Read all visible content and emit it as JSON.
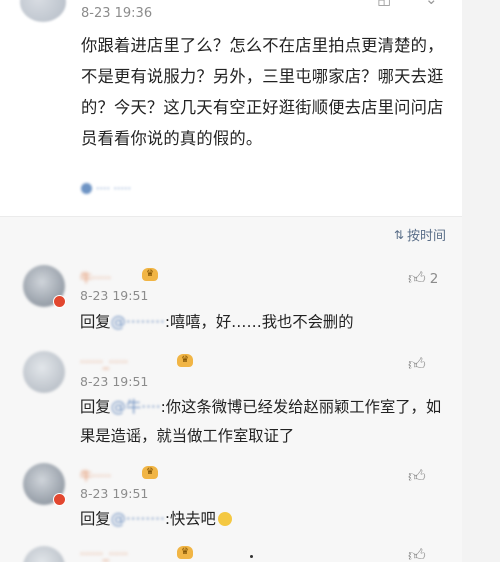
{
  "post": {
    "time": "8-23 19:36",
    "text": "你跟着进店里了么？怎么不在店里拍点更清楚的，不是更有说服力？另外，三里屯哪家店？哪天去逛的？今天？这几天有空正好逛街顺便去店里问问店员看看你说的真的假的。",
    "location_tag": "···· ·····",
    "actions": [
      "forward-icon",
      "more-icon"
    ]
  },
  "sort": {
    "label": "按时间",
    "icon": "sort-icon"
  },
  "comments": [
    {
      "name": "牛·····",
      "vip": "♛",
      "time": "8-23 19:51",
      "likes": "2",
      "reply_prefix": "回复",
      "mention": "@········",
      "text": ":嘻嘻，好……我也不会删的"
    },
    {
      "name": "······_·····",
      "vip": "♛",
      "time": "8-23 19:51",
      "likes": "",
      "reply_prefix": "回复",
      "mention": "@牛····",
      "text": ":你这条微博已经发给赵丽颖工作室了，如果是造谣，就当做工作室取证了"
    },
    {
      "name": "牛·····",
      "vip": "♛",
      "time": "8-23 19:51",
      "likes": "",
      "reply_prefix": "回复",
      "mention": "@········",
      "text": ":快去吧"
    },
    {
      "name": "······_·····",
      "vip": "♛",
      "time": "",
      "likes": "",
      "reply_prefix": "",
      "mention": "",
      "text": ""
    }
  ]
}
